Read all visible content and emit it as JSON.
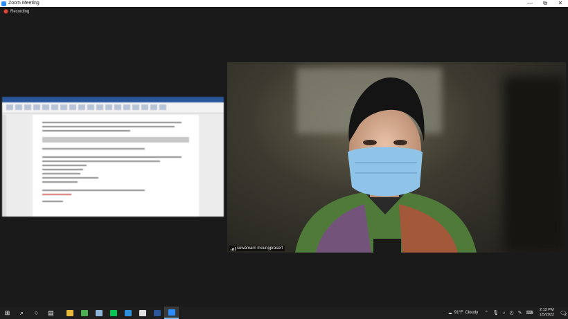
{
  "window": {
    "title": "Zoom Meeting",
    "controls": {
      "minimize": "—",
      "restore": "⧉",
      "close": "✕"
    }
  },
  "recording": {
    "label": "Recording"
  },
  "video": {
    "participant_name": "suwamarn moungprasert"
  },
  "taskbar": {
    "items": [
      {
        "name": "start-icon",
        "glyph": "⊞",
        "color": "#ffffff"
      },
      {
        "name": "search-icon",
        "glyph": "⌕",
        "color": "#ffffff"
      },
      {
        "name": "cortana-icon",
        "glyph": "○",
        "color": "#ffffff"
      },
      {
        "name": "task-view-icon",
        "glyph": "▤",
        "color": "#ffffff"
      },
      {
        "name": "file-explorer-icon",
        "color": "#e8b83a"
      },
      {
        "name": "chrome-icon",
        "color": "#4caf50"
      },
      {
        "name": "notepad-icon",
        "color": "#8fb6d8"
      },
      {
        "name": "line-icon",
        "color": "#06c755"
      },
      {
        "name": "edge-icon",
        "color": "#2f8fd8"
      },
      {
        "name": "acrobat-icon",
        "color": "#e0e0e0"
      },
      {
        "name": "word-icon",
        "color": "#2b579a"
      },
      {
        "name": "zoom-icon",
        "color": "#2d8cff"
      }
    ],
    "weather": {
      "temp": "91°F",
      "condition": "Cloudy"
    },
    "clock": {
      "time": "2:12 PM",
      "date": "1/5/2022"
    },
    "notifications": "2"
  }
}
